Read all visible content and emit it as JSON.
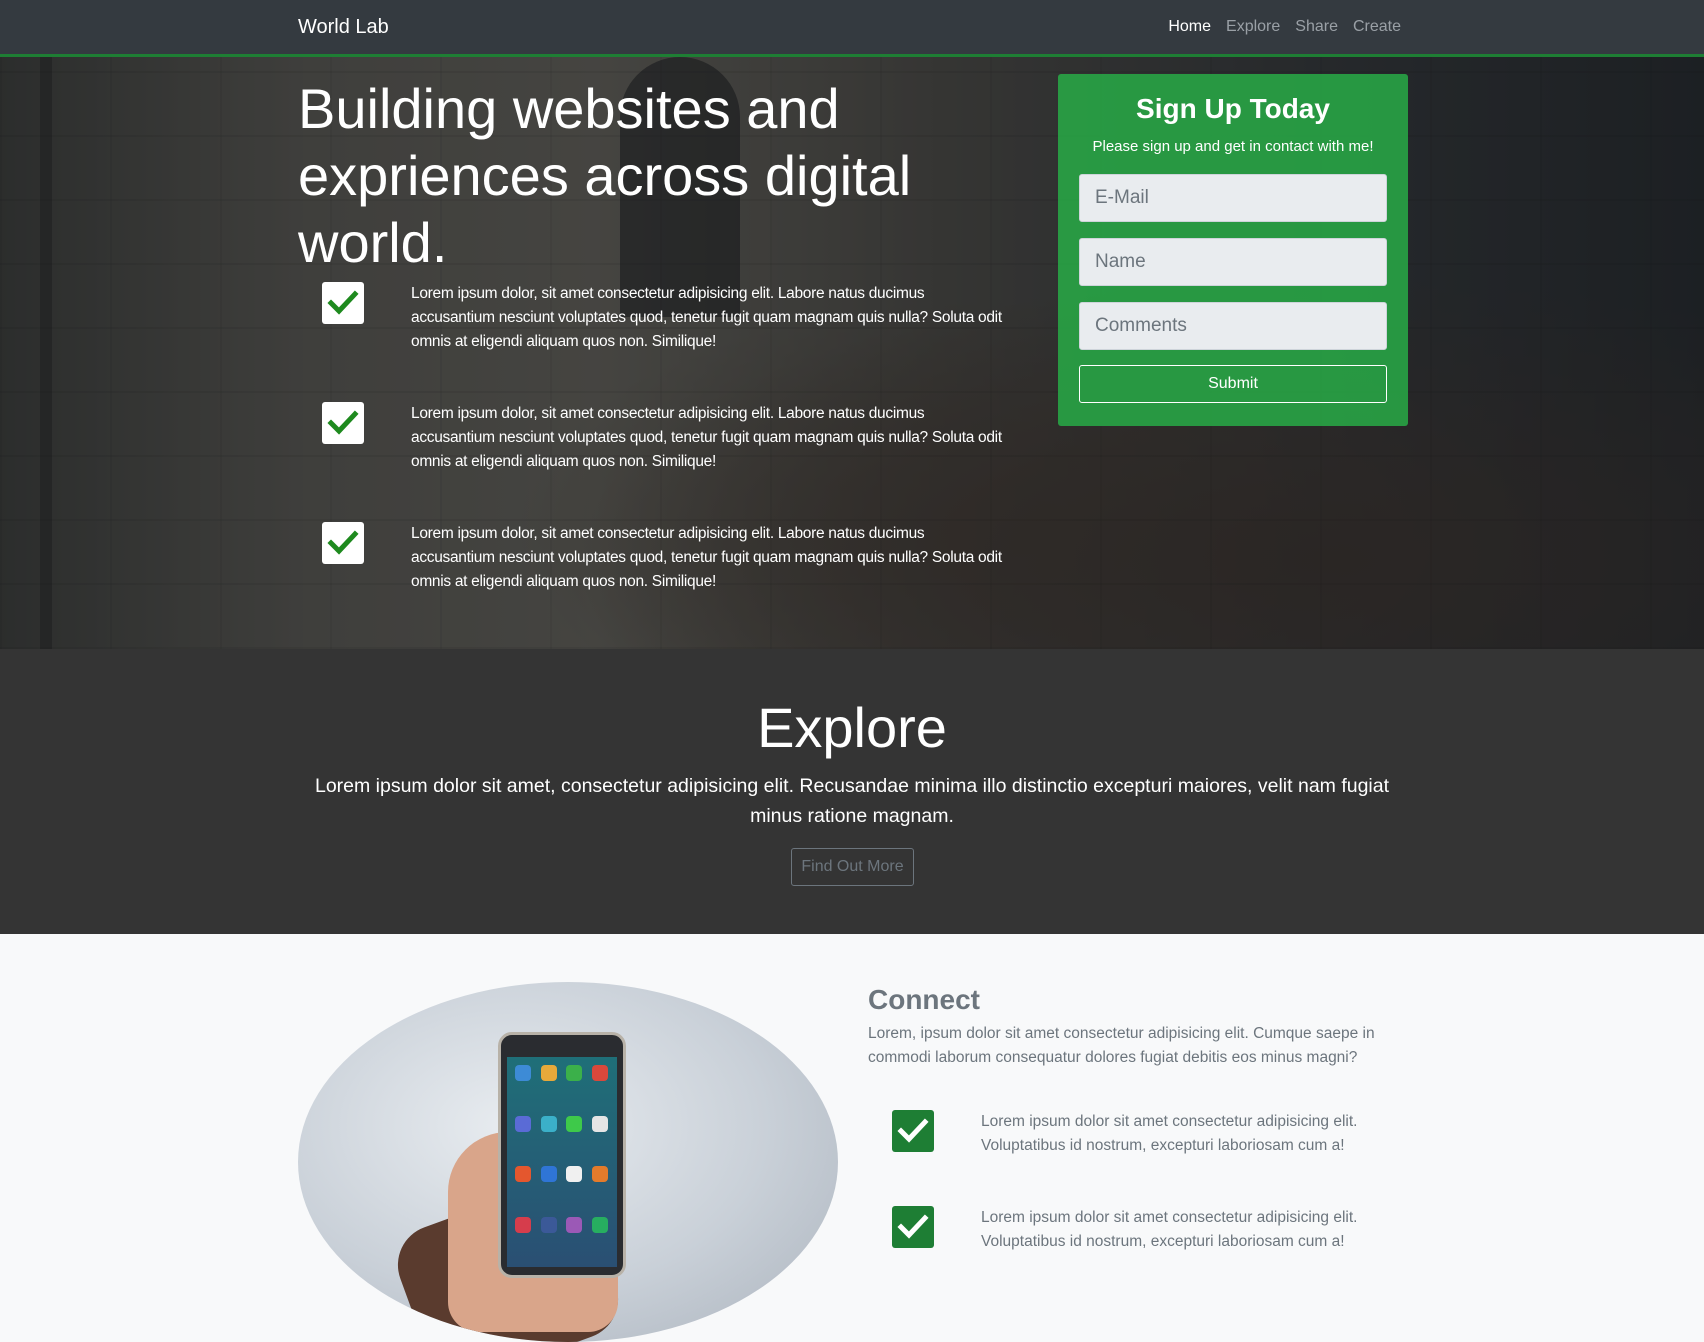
{
  "navbar": {
    "brand": "World Lab",
    "links": [
      "Home",
      "Explore",
      "Share",
      "Create"
    ],
    "active": "Home"
  },
  "hero": {
    "title": "Building websites and expriences across digital world.",
    "features": [
      "Lorem ipsum dolor, sit amet consectetur adipisicing elit. Labore natus ducimus accusantium nesciunt voluptates quod, tenetur fugit quam magnam quis nulla? Soluta odit omnis at eligendi aliquam quos non. Similique!",
      "Lorem ipsum dolor, sit amet consectetur adipisicing elit. Labore natus ducimus accusantium nesciunt voluptates quod, tenetur fugit quam magnam quis nulla? Soluta odit omnis at eligendi aliquam quos non. Similique!",
      "Lorem ipsum dolor, sit amet consectetur adipisicing elit. Labore natus ducimus accusantium nesciunt voluptates quod, tenetur fugit quam magnam quis nulla? Soluta odit omnis at eligendi aliquam quos non. Similique!"
    ]
  },
  "signup": {
    "title": "Sign Up Today",
    "subtitle": "Please sign up and get in contact with me!",
    "email_placeholder": "E-Mail",
    "name_placeholder": "Name",
    "comments_placeholder": "Comments",
    "submit_label": "Submit"
  },
  "explore": {
    "title": "Explore",
    "text": "Lorem ipsum dolor sit amet, consectetur adipisicing elit. Recusandae minima illo distinctio excepturi maiores, velit nam fugiat minus ratione magnam.",
    "button_label": "Find Out More"
  },
  "connect": {
    "title": "Connect",
    "text": "Lorem, ipsum dolor sit amet consectetur adipisicing elit. Cumque saepe in commodi laborum consequatur dolores fugiat debitis eos minus magni?",
    "features": [
      "Lorem ipsum dolor sit amet consectetur adipisicing elit. Voluptatibus id nostrum, excepturi laboriosam cum a!",
      "Lorem ipsum dolor sit amet consectetur adipisicing elit. Voluptatibus id nostrum, excepturi laboriosam cum a!"
    ]
  },
  "colors": {
    "navbar_bg": "#343a40",
    "accent_green": "#28a745",
    "dark_section": "#343434",
    "light_section": "#f8f9fa"
  }
}
